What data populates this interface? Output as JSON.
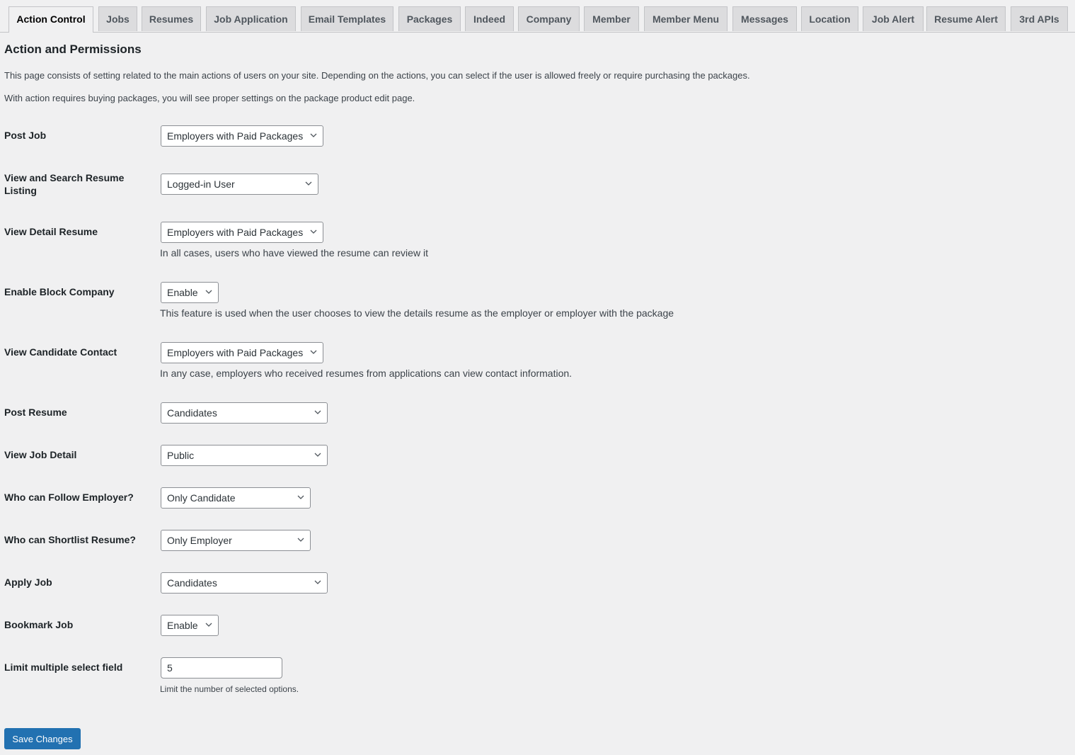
{
  "tabs": [
    {
      "label": "Action Control",
      "active": true
    },
    {
      "label": "Jobs"
    },
    {
      "label": "Resumes"
    },
    {
      "label": "Job Application"
    },
    {
      "label": "Email Templates"
    },
    {
      "label": "Packages"
    },
    {
      "label": "Indeed"
    },
    {
      "label": "Company"
    },
    {
      "label": "Member"
    },
    {
      "label": "Member Menu"
    },
    {
      "label": "Messages"
    },
    {
      "label": "Location"
    },
    {
      "label": "Job Alert"
    },
    {
      "label": "Resume Alert"
    },
    {
      "label": "3rd APIs"
    }
  ],
  "section": {
    "title": "Action and Permissions",
    "description_1": "This page consists of setting related to the main actions of users on your site. Depending on the actions, you can select if the user is allowed freely or require purchasing the packages.",
    "description_2": "With action requires buying packages, you will see proper settings on the package product edit page."
  },
  "settings": [
    {
      "label": "Post Job",
      "value": "Employers with Paid Packages"
    },
    {
      "label": "View and Search Resume Listing",
      "value": "Logged-in User"
    },
    {
      "label": "View Detail Resume",
      "value": "Employers with Paid Packages",
      "help": "In all cases, users who have viewed the resume can review it"
    },
    {
      "label": "Enable Block Company",
      "value": "Enable",
      "help": "This feature is used when the user chooses to view the details resume as the employer or employer with the package"
    },
    {
      "label": "View Candidate Contact",
      "value": "Employers with Paid Packages",
      "help": "In any case, employers who received resumes from applications can view contact information."
    },
    {
      "label": "Post Resume",
      "value": "Candidates"
    },
    {
      "label": "View Job Detail",
      "value": "Public"
    },
    {
      "label": "Who can Follow Employer?",
      "value": "Only Candidate"
    },
    {
      "label": "Who can Shortlist Resume?",
      "value": "Only Employer"
    },
    {
      "label": "Apply Job",
      "value": "Candidates"
    },
    {
      "label": "Bookmark Job",
      "value": "Enable"
    },
    {
      "label": "Limit multiple select field",
      "value": "5",
      "help": "Limit the number of selected options."
    }
  ],
  "icons": {
    "dropdown": "chevron-down-icon"
  },
  "save_button": "Save Changes"
}
